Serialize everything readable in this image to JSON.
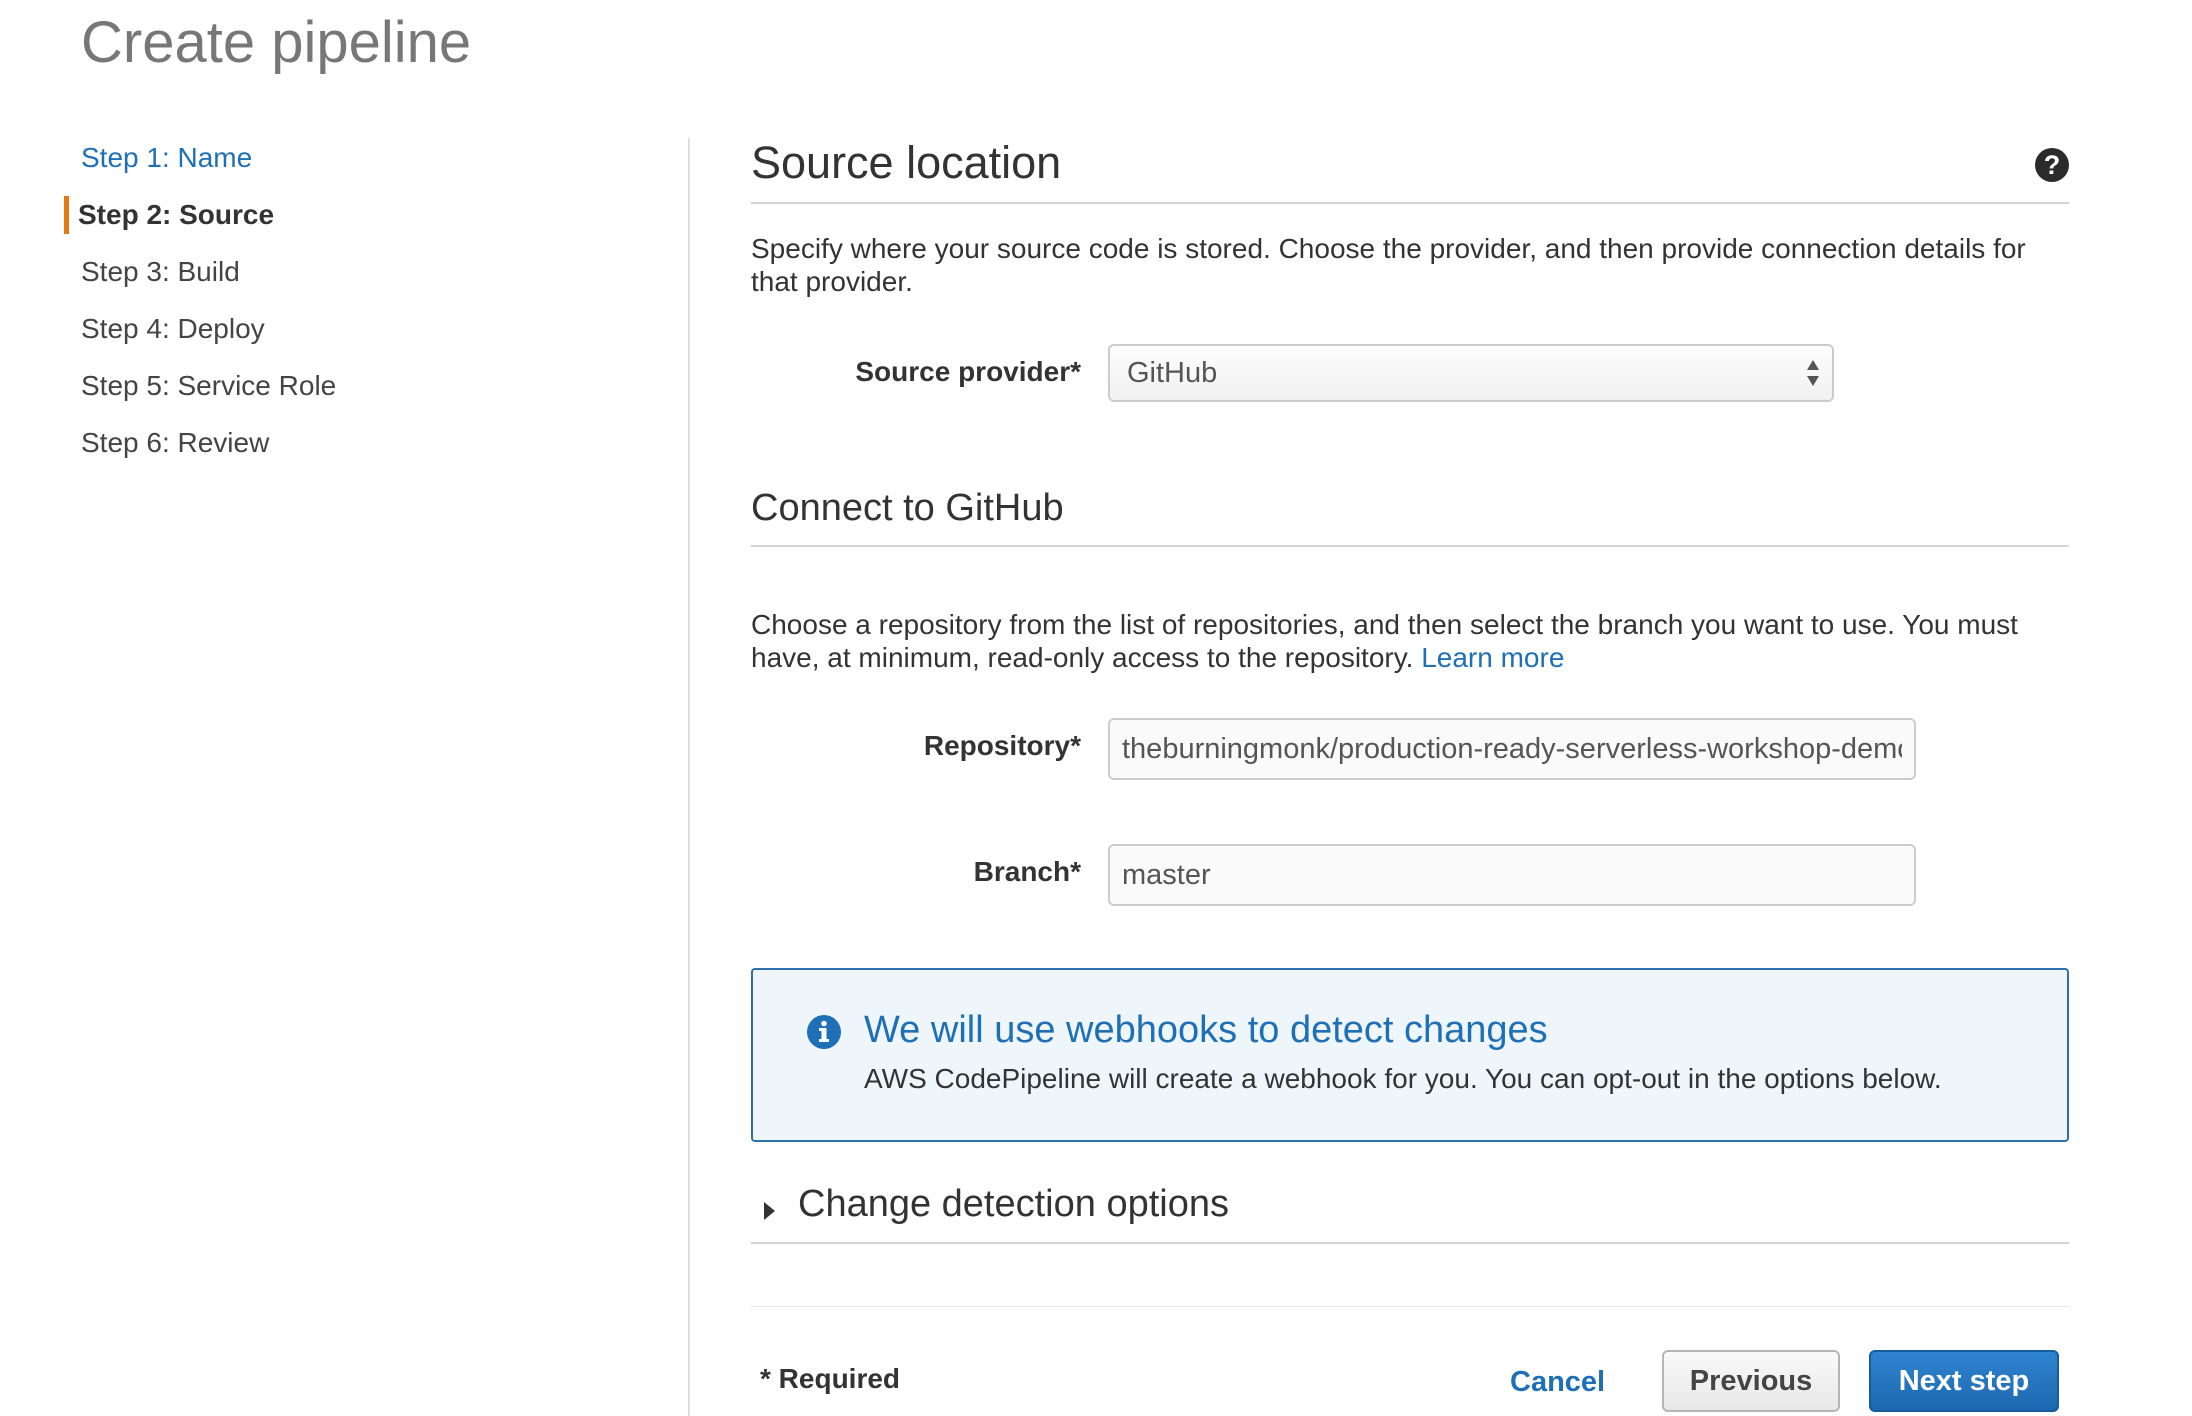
{
  "page": {
    "title": "Create pipeline"
  },
  "sidebar": {
    "steps": [
      {
        "label": "Step 1: Name",
        "state": "link"
      },
      {
        "label": "Step 2: Source",
        "state": "active"
      },
      {
        "label": "Step 3: Build",
        "state": "default"
      },
      {
        "label": "Step 4: Deploy",
        "state": "default"
      },
      {
        "label": "Step 5: Service Role",
        "state": "default"
      },
      {
        "label": "Step 6: Review",
        "state": "default"
      }
    ]
  },
  "source_location": {
    "title": "Source location",
    "help_icon": "?",
    "description": "Specify where your source code is stored. Choose the provider, and then provide connection details for that provider.",
    "provider_label": "Source provider*",
    "provider_value": "GitHub"
  },
  "github": {
    "title": "Connect to GitHub",
    "description": "Choose a repository from the list of repositories, and then select the branch you want to use. You must have, at minimum, read-only access to the repository.",
    "learn_more": "Learn more",
    "repository_label": "Repository*",
    "repository_value": "theburningmonk/production-ready-serverless-workshop-demo",
    "branch_label": "Branch*",
    "branch_value": "master"
  },
  "info": {
    "icon": "info-icon",
    "title": "We will use webhooks to detect changes",
    "text": "AWS CodePipeline will create a webhook for you. You can opt-out in the options below."
  },
  "change_detection": {
    "label": "Change detection options",
    "expanded": false
  },
  "footer": {
    "required": "* Required",
    "cancel": "Cancel",
    "previous": "Previous",
    "next": "Next step"
  },
  "colors": {
    "accent_active": "#e47911",
    "link": "#1f6fb6",
    "primary_button": "#1d68b0",
    "info_border": "#2f6fad",
    "info_background": "#eef6fb"
  }
}
